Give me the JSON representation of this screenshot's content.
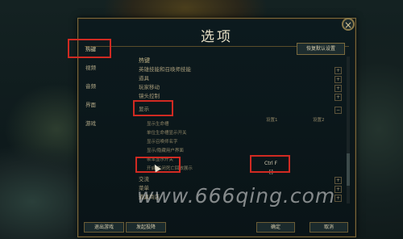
{
  "dialog": {
    "title": "选项",
    "close_symbol": "×"
  },
  "sidebar": {
    "items": [
      {
        "label": "热键"
      },
      {
        "label": "视频"
      },
      {
        "label": "音频"
      },
      {
        "label": "界面"
      },
      {
        "label": "游戏"
      }
    ]
  },
  "restore_defaults_label": "恢复默认设置",
  "hotkeys": {
    "section_title": "热键",
    "groups": [
      {
        "label": "英雄技能和召唤师技能"
      },
      {
        "label": "道具"
      },
      {
        "label": "玩家移动"
      },
      {
        "label": "镜头控制"
      }
    ],
    "display_section": "显示",
    "col1": "设置1",
    "col2": "设置2",
    "display_rows": [
      {
        "label": "显示生命槽"
      },
      {
        "label": "单位生命槽显示开关"
      },
      {
        "label": "显示召唤师名字"
      },
      {
        "label": "显示/隐藏用户界面"
      },
      {
        "label": "帧率显示开关",
        "binding1": "Ctrl F"
      },
      {
        "label": "开启/关闭死亡回放展示",
        "binding1": "[]"
      }
    ],
    "after_groups": [
      {
        "label": "交流"
      },
      {
        "label": "菜单"
      },
      {
        "label": "道具商店"
      }
    ]
  },
  "footer": {
    "exit_label": "退出游戏",
    "report_label": "发起投降",
    "ok_label": "确定",
    "cancel_label": "取消"
  },
  "watermark": "www.666qing.com",
  "colors": {
    "highlight": "#d12a22",
    "gold_border": "#7a6a3e"
  }
}
